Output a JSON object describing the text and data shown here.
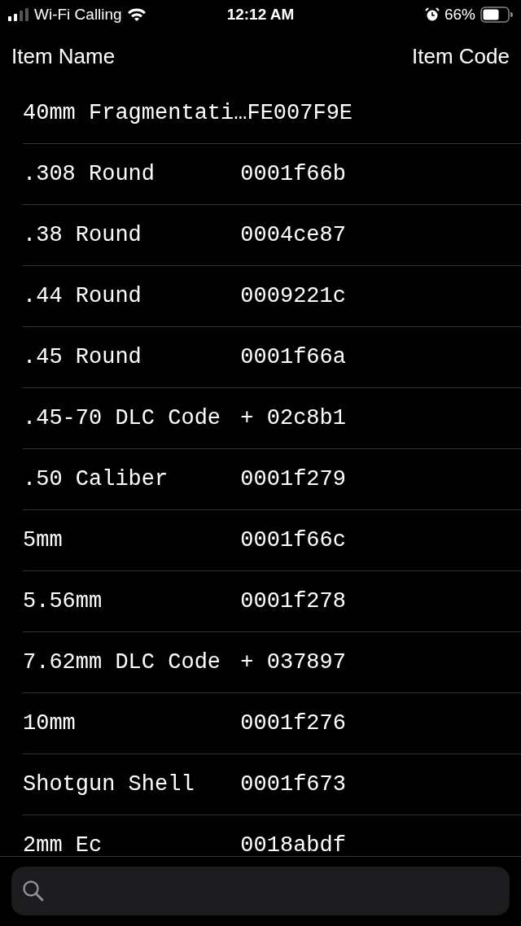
{
  "status_bar": {
    "carrier": "Wi-Fi Calling",
    "time": "12:12 AM",
    "battery": "66%"
  },
  "header": {
    "left": "Item Name",
    "right": "Item Code"
  },
  "rows": [
    {
      "name": "40mm Fragmentati…",
      "code": "FE007F9E"
    },
    {
      "name": ".308 Round",
      "code": "0001f66b"
    },
    {
      "name": ".38 Round",
      "code": "0004ce87"
    },
    {
      "name": ".44 Round",
      "code": "0009221c"
    },
    {
      "name": ".45 Round",
      "code": "0001f66a"
    },
    {
      "name": ".45-70 DLC Code",
      "code": "+ 02c8b1"
    },
    {
      "name": ".50 Caliber",
      "code": "0001f279"
    },
    {
      "name": "5mm",
      "code": "0001f66c"
    },
    {
      "name": "5.56mm",
      "code": "0001f278"
    },
    {
      "name": "7.62mm DLC Code",
      "code": "+ 037897"
    },
    {
      "name": "10mm",
      "code": "0001f276"
    },
    {
      "name": "Shotgun Shell",
      "code": "0001f673"
    },
    {
      "name": "2mm Ec",
      "code": "0018abdf"
    }
  ]
}
